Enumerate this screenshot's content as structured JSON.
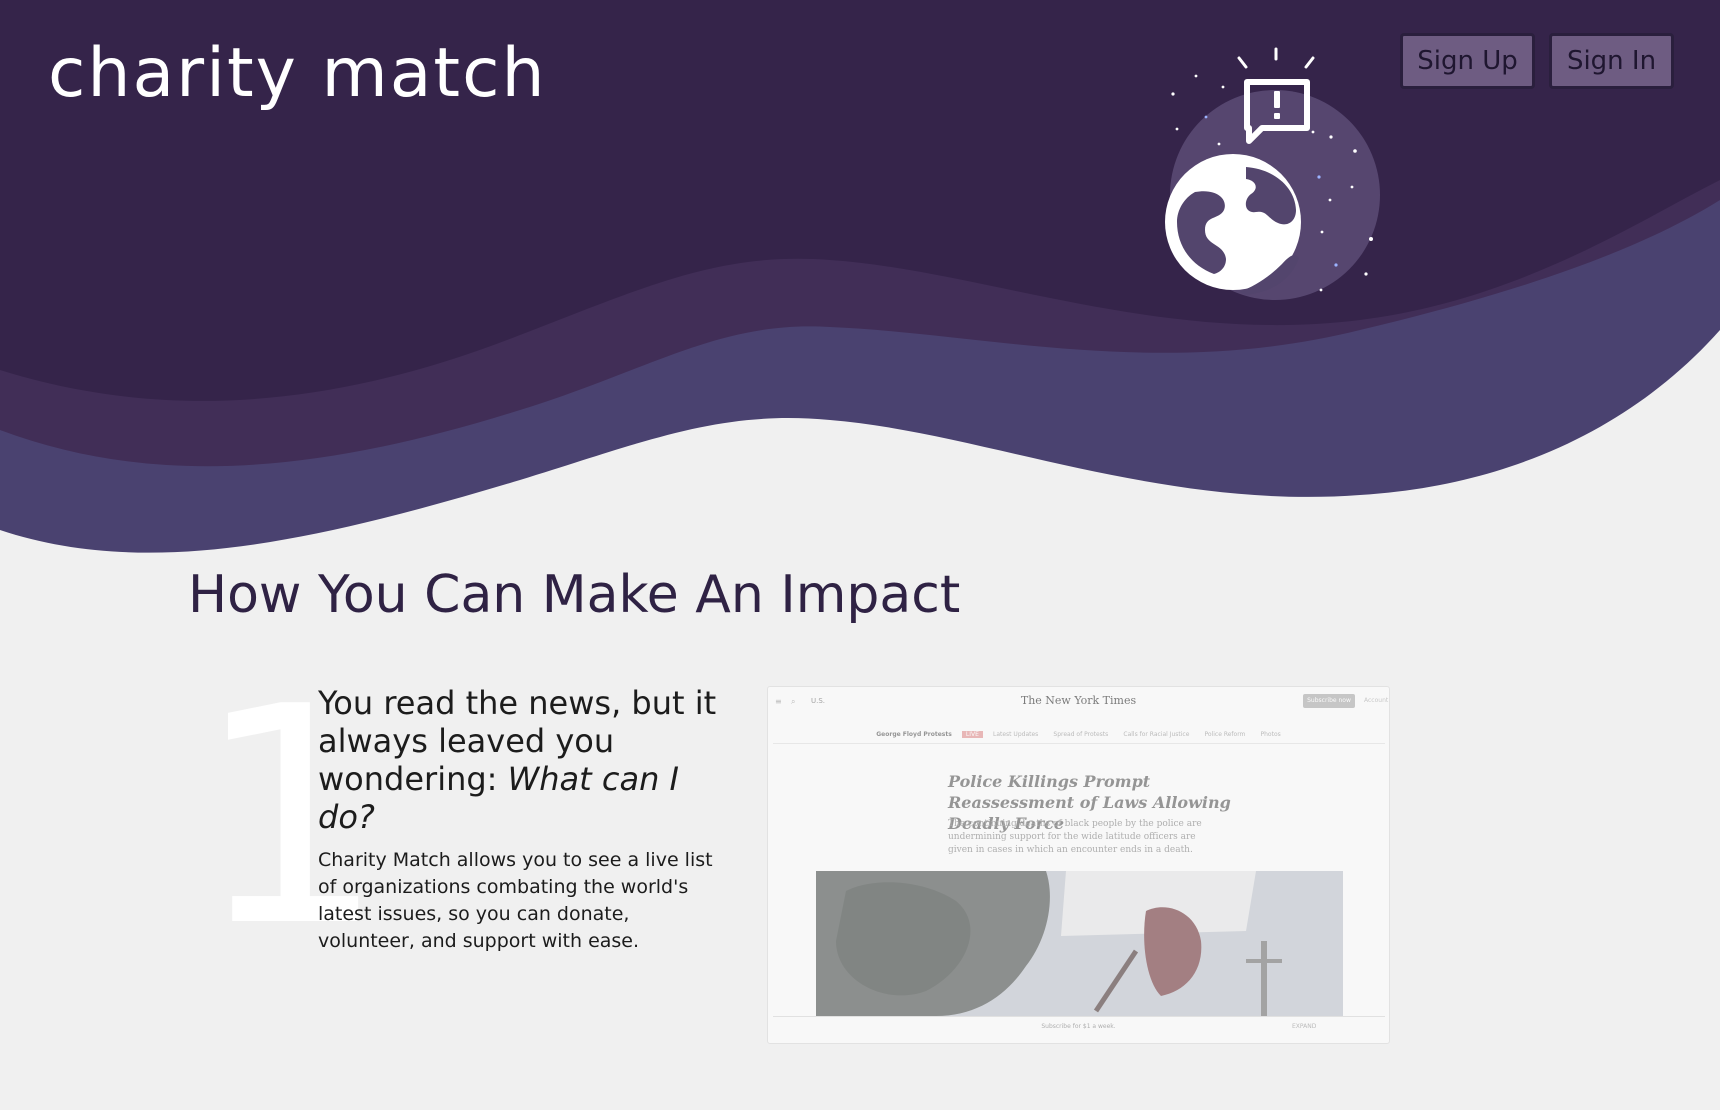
{
  "header": {
    "logo": "charity match",
    "signup_label": "Sign Up",
    "signin_label": "Sign In"
  },
  "hero": {
    "illustration_icons": [
      "alert-speech-bubble-icon",
      "globe-icon"
    ]
  },
  "section": {
    "title": "How You Can Make An Impact"
  },
  "step1": {
    "number": "1",
    "heading_plain": "You read the news, but it always leaved you wondering: ",
    "heading_emph": "What can I do?",
    "body": "Charity Match allows you to see a live list of organizations combating the world's latest issues, so you can donate, volunteer, and support with ease."
  },
  "preview": {
    "section_label": "U.S.",
    "masthead": "The New York Times",
    "subscribe_label": "Subscribe now",
    "account_label": "Account",
    "topics": {
      "main": "George Floyd Protests",
      "live": "LIVE",
      "t1": "Latest Updates",
      "t2": "Spread of Protests",
      "t3": "Calls for Racial Justice",
      "t4": "Police Reform",
      "t5": "Photos"
    },
    "headline": "Police Killings Prompt Reassessment of Laws Allowing Deadly Force",
    "dek": "The continuing deaths of black people by the police are undermining support for the wide latitude officers are given in cases in which an encounter ends in a death.",
    "footer": "Subscribe for $1 a week.",
    "expand_label": "EXPAND"
  },
  "colors": {
    "hero_dark": "#35244a",
    "wave_mid": "#412e57",
    "wave_light": "#4a4270",
    "page_bg": "#f0f0f0",
    "title": "#2f2244",
    "button_bg": "#6e5c82"
  }
}
